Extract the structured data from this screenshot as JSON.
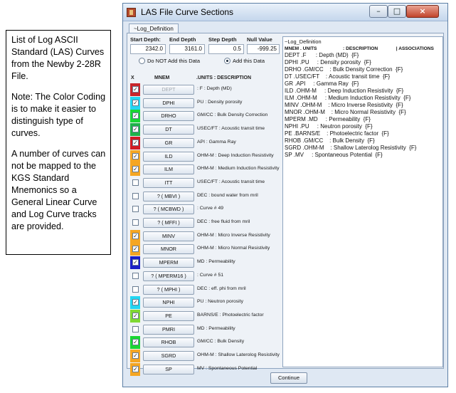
{
  "note": {
    "paragraphs": [
      "List of Log ASCII Standard (LAS) Curves from the Newby 2-28R File.",
      "Note: The Color Coding is to make it easier to distinguish type of curves.",
      "A number of curves can not be mapped to the KGS Standard Mnemonics so a General Linear Curve and Log Curve tracks are provided."
    ]
  },
  "window": {
    "title": "LAS File Curve Sections",
    "minimize": "–",
    "maximize": "□",
    "close": "×",
    "tab": "~Log_Definition",
    "continue": "Continue"
  },
  "fields": {
    "start_depth": {
      "label": "Start Depth:",
      "value": "2342.0"
    },
    "end_depth": {
      "label": "End Depth",
      "value": "3161.0"
    },
    "step_depth": {
      "label": "Step Depth",
      "value": "0.5"
    },
    "null_value": {
      "label": "Null Value",
      "value": "-999.25"
    }
  },
  "radios": {
    "do_not_add": {
      "label": "Do NOT Add this Data",
      "selected": false
    },
    "add": {
      "label": "Add this Data",
      "selected": true
    }
  },
  "columns": {
    "x": "X",
    "mnem": "MNEM",
    "units_desc": ".UNITS : DESCRIPTION"
  },
  "rows": [
    {
      "mnem": "DEPT",
      "desc": ": F : Depth (MD)",
      "color": "#c8262b",
      "checked": true,
      "enabled": false
    },
    {
      "mnem": "DPHI",
      "desc": "PU : Density porosity",
      "color": "#22d6f2",
      "checked": true,
      "enabled": true
    },
    {
      "mnem": "DRHO",
      "desc": "GM/CC : Bulk Density Correction",
      "color": "#19d633",
      "checked": true,
      "enabled": true
    },
    {
      "mnem": "DT",
      "desc": "USEC/FT : Acoustic transit time",
      "color": "#1fb24a",
      "checked": true,
      "enabled": true
    },
    {
      "mnem": "GR",
      "desc": "API : Gamma Ray",
      "color": "#d21c24",
      "checked": true,
      "enabled": true
    },
    {
      "mnem": "ILD",
      "desc": "OHM-M : Deep Induction Resistivity",
      "color": "#f5a623",
      "checked": true,
      "enabled": true
    },
    {
      "mnem": "ILM",
      "desc": "OHM-M : Medium Induction Resistivity",
      "color": "#f5a623",
      "checked": true,
      "enabled": true
    },
    {
      "mnem": "ITT",
      "desc": "USEC/FT : Acoustic transit time",
      "color": "",
      "checked": false,
      "enabled": true
    },
    {
      "mnem": "? ( MBVI )",
      "desc": "DEC : bound water from mril",
      "color": "",
      "checked": false,
      "enabled": true
    },
    {
      "mnem": "? ( MCBWD )",
      "desc": ": Curve # 49",
      "color": "",
      "checked": false,
      "enabled": true
    },
    {
      "mnem": "? ( MFFI )",
      "desc": "DEC : free fluid from mril",
      "color": "",
      "checked": false,
      "enabled": true
    },
    {
      "mnem": "MINV",
      "desc": "OHM-M : Micro Inverse Resistivity",
      "color": "#f5a623",
      "checked": true,
      "enabled": true
    },
    {
      "mnem": "MNOR",
      "desc": "OHM-M : Micro Normal Resistivity",
      "color": "#f5a623",
      "checked": true,
      "enabled": true
    },
    {
      "mnem": "MPERM",
      "desc": "MD : Permeability",
      "color": "#1b1fc7",
      "checked": true,
      "enabled": true
    },
    {
      "mnem": "? ( MPERM16 )",
      "desc": ": Curve # 51",
      "color": "",
      "checked": false,
      "enabled": true
    },
    {
      "mnem": "? ( MPHI )",
      "desc": "DEC : eff. phi from mril",
      "color": "",
      "checked": false,
      "enabled": true
    },
    {
      "mnem": "NPHI",
      "desc": "PU : Neutron porosity",
      "color": "#22d6f2",
      "checked": true,
      "enabled": true
    },
    {
      "mnem": "PE",
      "desc": "BARNS/E : Photoelectric factor",
      "color": "#7fd832",
      "checked": true,
      "enabled": true
    },
    {
      "mnem": "PMRI",
      "desc": "MD : Permeability",
      "color": "",
      "checked": false,
      "enabled": true
    },
    {
      "mnem": "RHOB",
      "desc": "GM/CC : Bulk Density",
      "color": "#19d633",
      "checked": true,
      "enabled": true
    },
    {
      "mnem": "SGRD",
      "desc": "OHM-M : Shallow Laterolog Resistivity",
      "color": "#f5a623",
      "checked": true,
      "enabled": true
    },
    {
      "mnem": "SP",
      "desc": "MV : Spontaneous Potential",
      "color": "#f5a623",
      "checked": true,
      "enabled": true
    }
  ],
  "textarea": {
    "header1": "~Log_Definition",
    "header2": "MNEM . UNITS                    : DESCRIPTION              | ASSOCIATIONS",
    "lines": [
      "DEPT .F      : Depth (MD)  {F}",
      "DPHI .PU     : Density porosity  {F}",
      "DRHO .GM/CC    : Bulk Density Correction  {F}",
      "DT .USEC/FT    : Acoustic transit time  {F}",
      "GR .API     : Gamma Ray  {F}",
      "ILD .OHM-M     : Deep Induction Resistivity  {F}",
      "ILM .OHM-M     : Medium Induction Resistivity  {F}",
      "MINV .OHM-M    : Micro Inverse Resistivity  {F}",
      "MNOR .OHM-M    : Micro Normal Resistivity  {F}",
      "MPERM .MD     : Permeability  {F}",
      "NPHI .PU     : Neutron porosity  {F}",
      "PE .BARNS/E    : Photoelectric factor  {F}",
      "RHOB .GM/CC    : Bulk Density  {F}",
      "SGRD .OHM-M    : Shallow Laterolog Resistivity  {F}",
      "SP .MV     : Spontaneous Potential  {F}"
    ]
  }
}
